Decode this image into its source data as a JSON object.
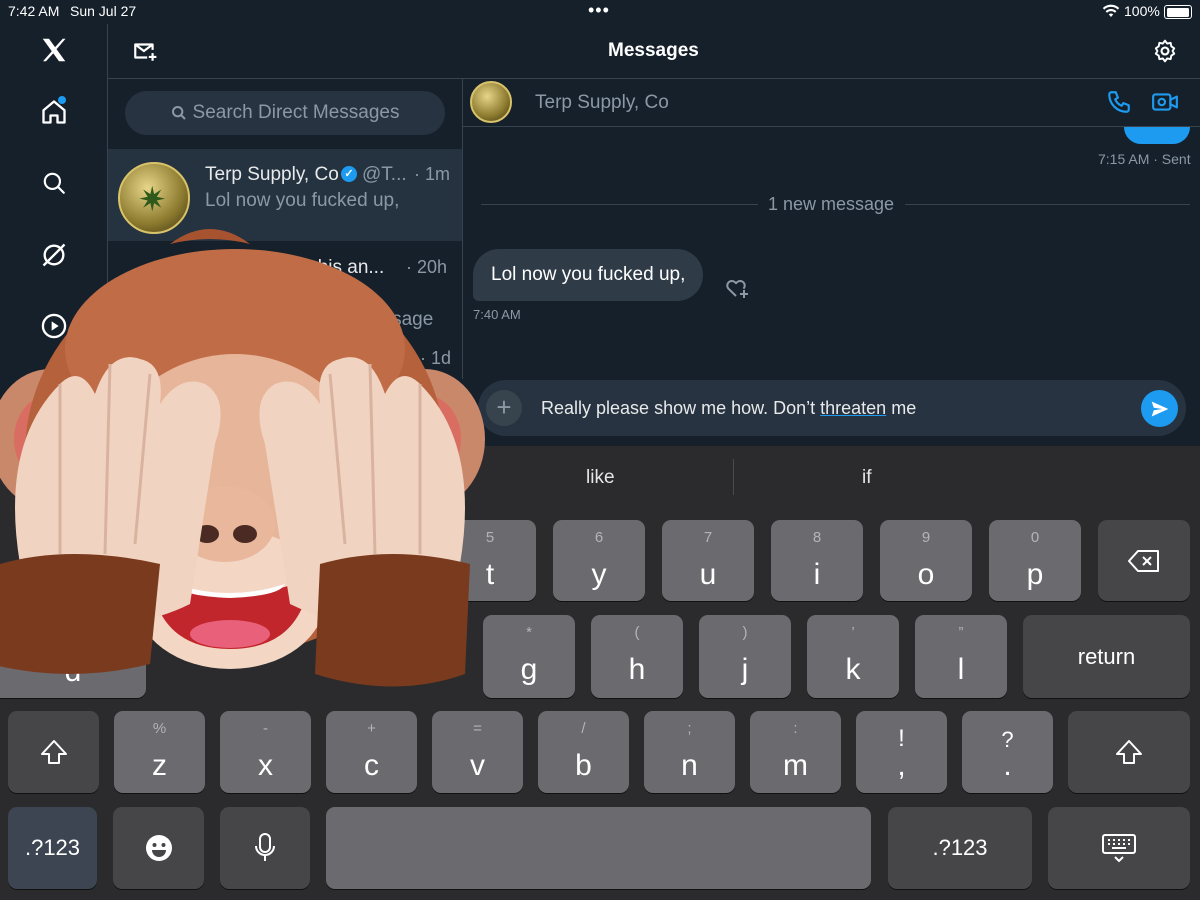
{
  "status_bar": {
    "time": "7:42 AM",
    "date": "Sun Jul 27",
    "battery": "100%",
    "dots": "•••"
  },
  "header": {
    "title": "Messages"
  },
  "search": {
    "placeholder": "Search Direct Messages"
  },
  "conversations": [
    {
      "name": "Terp Supply, Co",
      "handle": "@T...",
      "time": "· 1m",
      "preview": "Lol now you fucked up,",
      "verified": true
    },
    {
      "name": "nnabis an...",
      "time": "· 20h",
      "preview": "essage"
    },
    {
      "time": "· 1d"
    }
  ],
  "chat": {
    "contact_name": "Terp Supply, Co",
    "sent_meta": "7:15 AM · Sent",
    "new_message_divider": "1 new message",
    "received": {
      "text": "Lol now you fucked up,",
      "time": "7:40 AM"
    },
    "composer": {
      "before": "Really please show me how. Don’t ",
      "underlined": "threaten",
      "after": " me"
    }
  },
  "keyboard": {
    "suggestions": [
      "like",
      "if"
    ],
    "row1": [
      {
        "main": "t",
        "sub": "5"
      },
      {
        "main": "y",
        "sub": "6"
      },
      {
        "main": "u",
        "sub": "7"
      },
      {
        "main": "i",
        "sub": "8"
      },
      {
        "main": "o",
        "sub": "9"
      },
      {
        "main": "p",
        "sub": "0"
      }
    ],
    "row2": [
      {
        "main": "g",
        "sub": "*"
      },
      {
        "main": "h",
        "sub": "("
      },
      {
        "main": "j",
        "sub": ")"
      },
      {
        "main": "k",
        "sub": "’"
      },
      {
        "main": "l",
        "sub": "”"
      }
    ],
    "return_label": "return",
    "row2_partial": "d",
    "row3": [
      {
        "main": "z",
        "sub": "%"
      },
      {
        "main": "x",
        "sub": "-"
      },
      {
        "main": "c",
        "sub": "+"
      },
      {
        "main": "v",
        "sub": "="
      },
      {
        "main": "b",
        "sub": "/"
      },
      {
        "main": "n",
        "sub": ";"
      },
      {
        "main": "m",
        "sub": ":"
      },
      {
        "main": ",",
        "sub": "!"
      },
      {
        "main": ".",
        "sub": "?"
      }
    ],
    "numbers_label": ".?123"
  },
  "icons": {
    "logo": "x-logo-icon",
    "home": "home-icon",
    "search": "search-icon",
    "grok": "grok-icon",
    "video": "play-icon",
    "compose": "new-message-icon",
    "settings": "gear-icon",
    "call": "phone-icon",
    "videocall": "video-camera-icon",
    "send": "send-icon",
    "shift": "shift-icon",
    "delete": "backspace-icon",
    "emoji": "emoji-icon",
    "mic": "microphone-icon",
    "hide_keyboard": "keyboard-dismiss-icon",
    "sticker": "see-no-evil-monkey-memoji"
  },
  "colors": {
    "background": "#15202b",
    "accent": "#1d9bf0",
    "keyboard": "#2b2b2d",
    "key": "#6b6b6f"
  }
}
